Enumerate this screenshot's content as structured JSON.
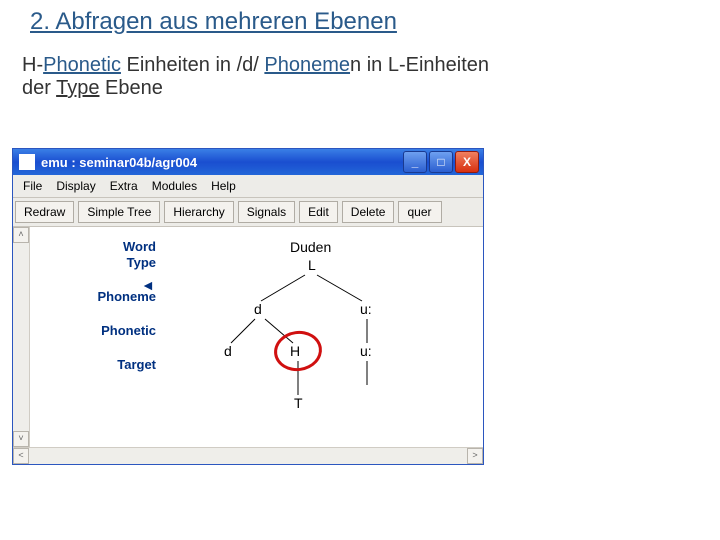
{
  "slide": {
    "title": "2. Abfragen aus mehreren Ebenen",
    "line1_pre": "H-",
    "line1_uc": "Phonetic",
    "line1_mid": " Einheiten in /d/ ",
    "line1_uc2": "Phoneme",
    "line1_post": "n in L-Einheiten",
    "line2_pre": "der ",
    "line2_uc": "Type",
    "line2_post": " Ebene"
  },
  "window": {
    "title": "emu : seminar04b/agr004"
  },
  "menu": {
    "file": "File",
    "display": "Display",
    "extra": "Extra",
    "modules": "Modules",
    "help": "Help"
  },
  "toolbar": {
    "redraw": "Redraw",
    "simpletree": "Simple Tree",
    "hierarchy": "Hierarchy",
    "signals": "Signals",
    "edit": "Edit",
    "delete": "Delete",
    "query": "quer"
  },
  "tiers": {
    "word": "Word",
    "type": "Type",
    "phoneme": "Phoneme",
    "phonetic": "Phonetic",
    "target": "Target",
    "marker": "◄"
  },
  "tree": {
    "duden": "Duden",
    "L": "L",
    "d1": "d",
    "u1": "u:",
    "d2": "d",
    "H": "H",
    "u2": "u:",
    "T": "T"
  },
  "scroll": {
    "up": "˄",
    "down": "˅",
    "left": "<",
    "right": ">"
  }
}
